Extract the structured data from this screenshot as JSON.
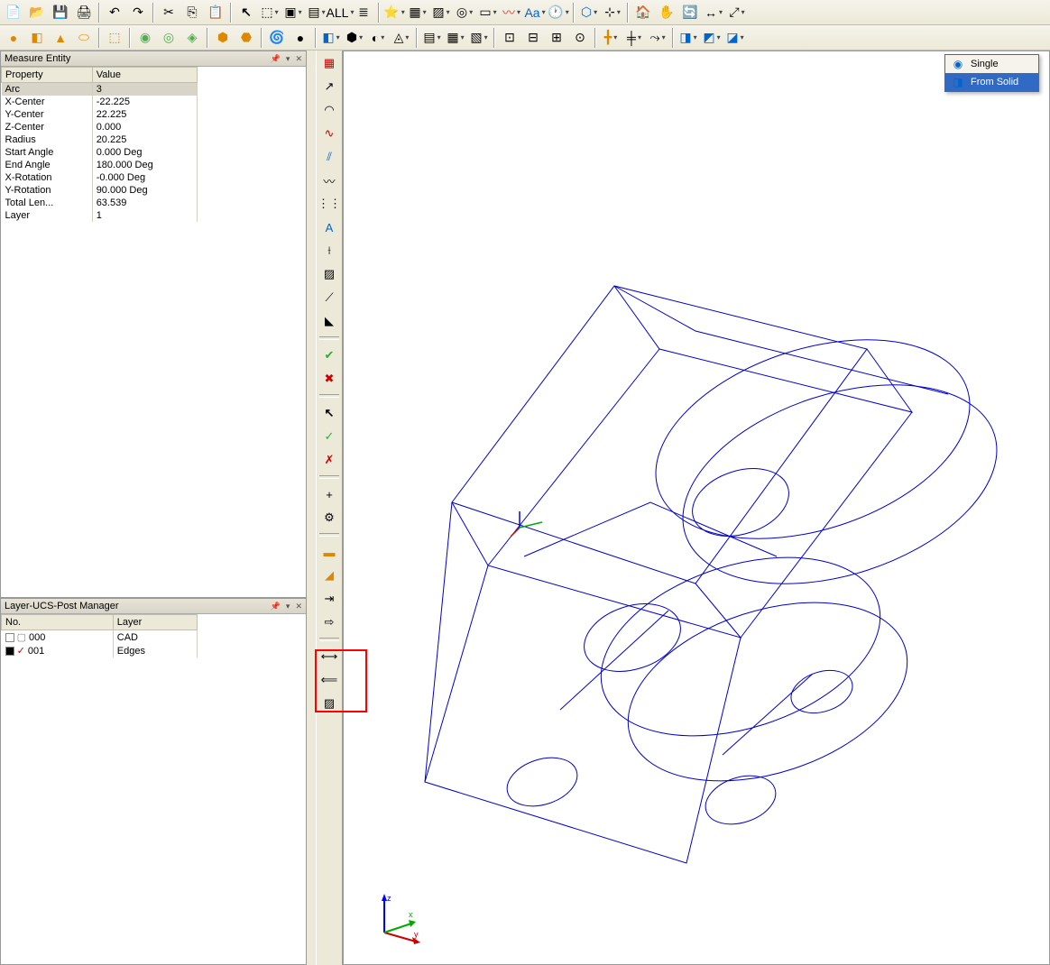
{
  "measure_panel": {
    "title": "Measure Entity",
    "headers": [
      "Property",
      "Value"
    ],
    "rows": [
      {
        "prop": "Arc",
        "val": "3",
        "sel": true
      },
      {
        "prop": "X-Center",
        "val": "-22.225"
      },
      {
        "prop": "Y-Center",
        "val": "22.225"
      },
      {
        "prop": "Z-Center",
        "val": "0.000"
      },
      {
        "prop": "Radius",
        "val": "20.225"
      },
      {
        "prop": "Start Angle",
        "val": "0.000 Deg"
      },
      {
        "prop": "End Angle",
        "val": "180.000 Deg"
      },
      {
        "prop": "X-Rotation",
        "val": "-0.000 Deg"
      },
      {
        "prop": "Y-Rotation",
        "val": "90.000 Deg"
      },
      {
        "prop": "Total Len...",
        "val": "63.539"
      },
      {
        "prop": "Layer",
        "val": "1"
      }
    ]
  },
  "layer_panel": {
    "title": "Layer-UCS-Post Manager",
    "headers": [
      "No.",
      "Layer"
    ],
    "rows": [
      {
        "no": "000",
        "layer": "CAD",
        "color": "#fff"
      },
      {
        "no": "001",
        "layer": "Edges",
        "color": "#000",
        "checked": true
      }
    ]
  },
  "dropdown": {
    "items": [
      {
        "label": "Single",
        "icon": "◉"
      },
      {
        "label": "From Solid",
        "icon": "◨",
        "hover": true
      }
    ]
  },
  "toolbar_text": {
    "all": "ALL",
    "aa": "Aa"
  },
  "axis_labels": {
    "x": "x",
    "y": "y",
    "z": "z"
  }
}
